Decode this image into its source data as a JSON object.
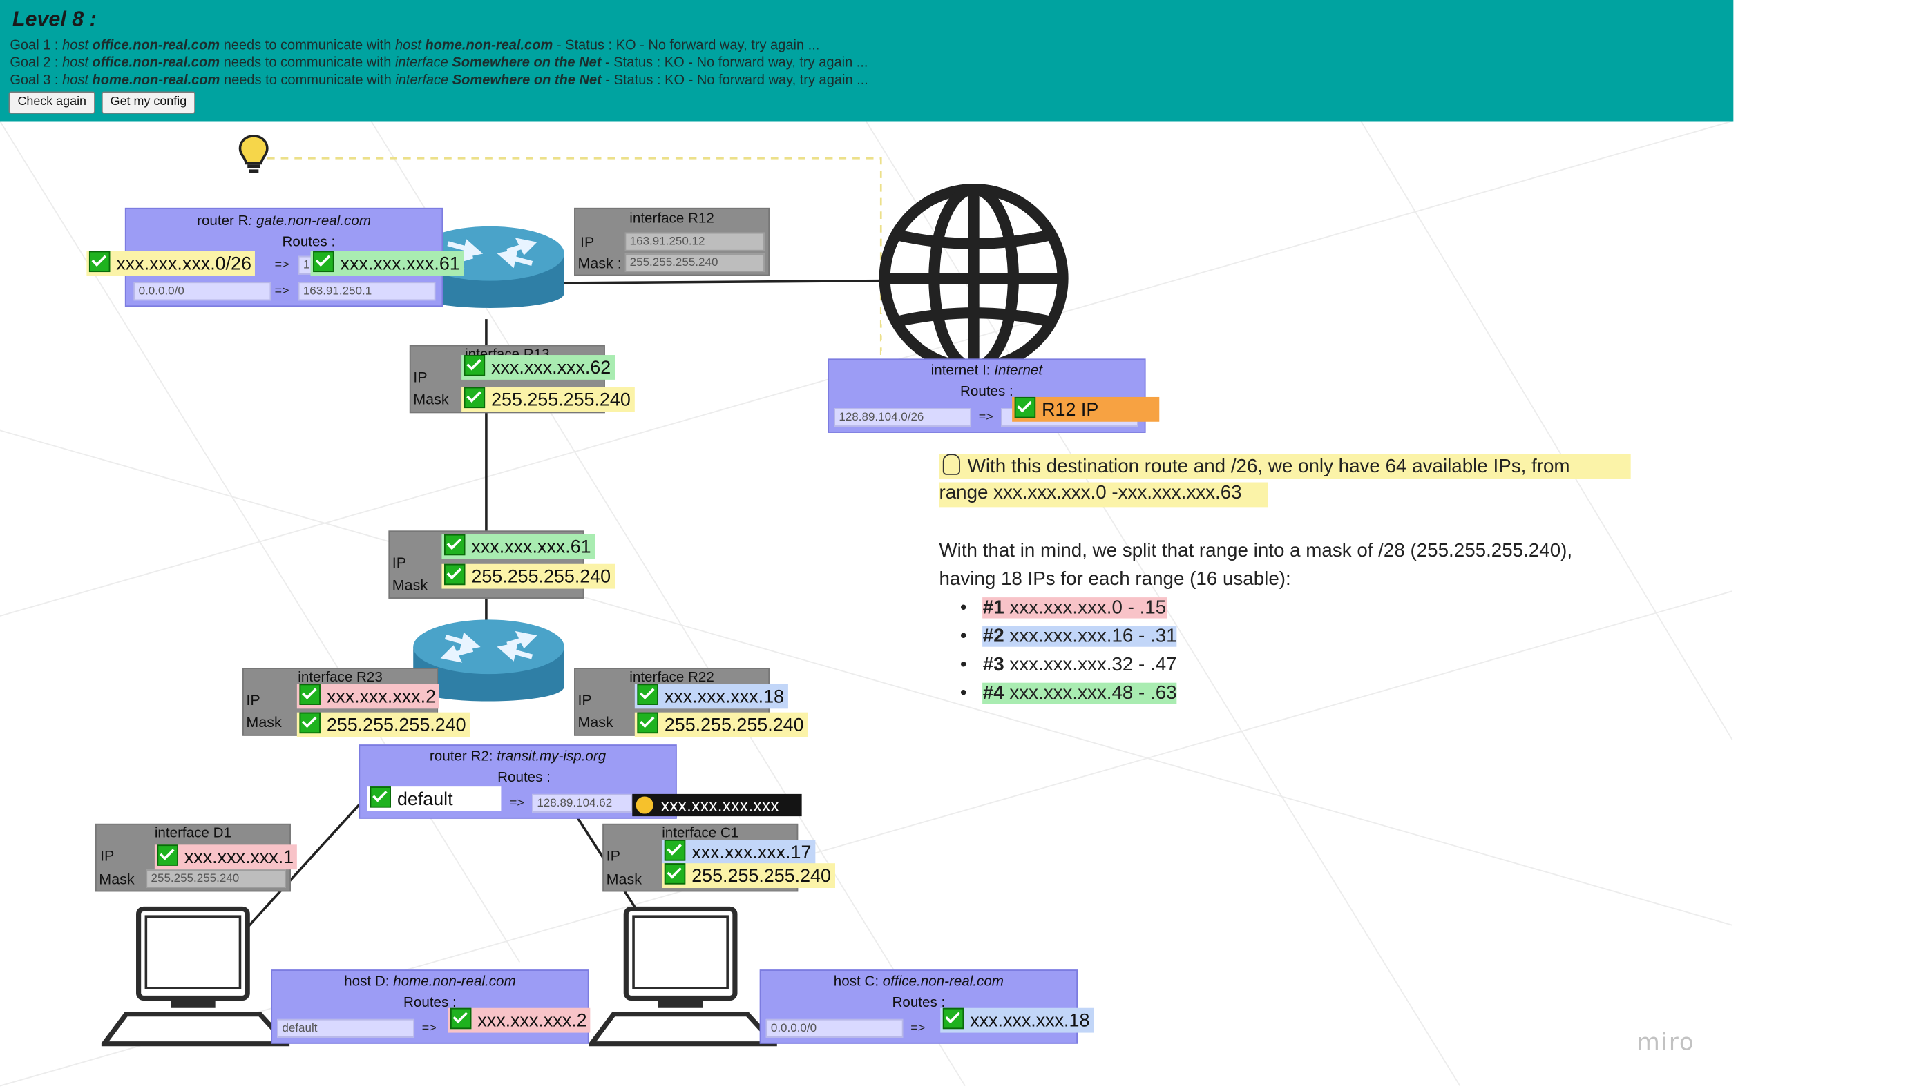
{
  "header": {
    "level": "Level 8 :",
    "goals": [
      {
        "prefix": "Goal 1 : ",
        "t1": "host ",
        "b1": "office.non-real.com",
        "m": " needs to communicate with ",
        "t2": "host ",
        "b2": "home.non-real.com",
        "status": " - Status : KO - No forward way, try again ..."
      },
      {
        "prefix": "Goal 2 : ",
        "t1": "host ",
        "b1": "office.non-real.com",
        "m": " needs to communicate with ",
        "t2": "interface ",
        "b2": "Somewhere on the Net",
        "status": " - Status : KO - No forward way, try again ..."
      },
      {
        "prefix": "Goal 3 : ",
        "t1": "host ",
        "b1": "home.non-real.com",
        "m": " needs to communicate with ",
        "t2": "interface ",
        "b2": "Somewhere on the Net",
        "status": " - Status : KO - No forward way, try again ..."
      }
    ],
    "check_again": "Check again",
    "get_config": "Get my config"
  },
  "router_r1": {
    "title_prefix": "router R",
    "title_rest": ": gate.non-real.com",
    "routes": "Routes :",
    "row1_dest": "xxx.xxx.xxx.0/26",
    "row1_arrow": "=>",
    "row1_mini": "1",
    "row1_next": "xxx.xxx.xxx.61",
    "row2_dest": "0.0.0.0/0",
    "row2_arrow": "=>",
    "row2_next": "163.91.250.1"
  },
  "iface_r12": {
    "title": "interface R12",
    "ip_label": "IP",
    "mask_label": "Mask :",
    "ip": "163.91.250.12",
    "mask": "255.255.255.240"
  },
  "iface_r13": {
    "title": "interface R13",
    "ip_label": "IP",
    "mask_label": "Mask",
    "ip": "xxx.xxx.xxx.62",
    "mask": "255.255.255.240"
  },
  "iface_r21": {
    "ip_label": "IP",
    "mask_label": "Mask",
    "ip": "xxx.xxx.xxx.61",
    "mask": "255.255.255.240"
  },
  "iface_r23": {
    "title": "interface R23",
    "ip_label": "IP",
    "mask_label": "Mask",
    "ip": "xxx.xxx.xxx.2",
    "mask": "255.255.255.240"
  },
  "iface_r22": {
    "title": "interface R22",
    "ip_label": "IP",
    "mask_label": "Mask",
    "ip": "xxx.xxx.xxx.18",
    "mask": "255.255.255.240"
  },
  "router_r2": {
    "title_prefix": "router R2: ",
    "title_rest": "transit.my-isp.org",
    "routes": "Routes :",
    "row1_dest": "default",
    "row1_arrow": "=>",
    "row1_next": "128.89.104.62",
    "row1_tag": "xxx.xxx.xxx.xxx"
  },
  "iface_d1": {
    "title": "interface D1",
    "ip_label": "IP",
    "mask_label": "Mask",
    "ip": "xxx.xxx.xxx.1",
    "mask": "255.255.255.240"
  },
  "iface_c1": {
    "title": "interface C1",
    "ip_label": "IP",
    "mask_label": "Mask",
    "ip": "xxx.xxx.xxx.17",
    "mask": "255.255.255.240"
  },
  "internet": {
    "title_prefix": "internet I: ",
    "title_rest": "Internet",
    "routes": "Routes :",
    "dest": "128.89.104.0/26",
    "arrow": "=>",
    "next": "R12 IP"
  },
  "host_d": {
    "title_prefix": "host D: ",
    "title_rest": "home.non-real.com",
    "routes": "Routes :",
    "dest": "default",
    "arrow": "=>",
    "next": "xxx.xxx.xxx.2"
  },
  "host_c": {
    "title_prefix": "host C: ",
    "title_rest": "office.non-real.com",
    "routes": "Routes :",
    "dest": "0.0.0.0/0",
    "arrow": "=>",
    "next": "xxx.xxx.xxx.18"
  },
  "notes": {
    "line1": "With this destination route and /26, we only have 64 available IPs, from",
    "line2": "range xxx.xxx.xxx.0 -xxx.xxx.xxx.63",
    "line3": "With that in mind, we split that range into a mask of /28 (255.255.255.240),",
    "line4": "having 18 IPs for each range (16 usable):",
    "items": [
      {
        "num": "#1",
        "range": " xxx.xxx.xxx.0 - .15"
      },
      {
        "num": "#2",
        "range": " xxx.xxx.xxx.16 - .31"
      },
      {
        "num": "#3",
        "range": " xxx.xxx.xxx.32 - .47"
      },
      {
        "num": "#4",
        "range": " xxx.xxx.xxx.48 - .63"
      }
    ]
  },
  "watermark": "miro",
  "colors": {
    "header_bg": "#00a3a0",
    "panel_purple": "#9c9cf5",
    "panel_gray": "#8c8c8c",
    "sticky_green": "#a9ecb1",
    "sticky_yellow": "#fbf3a8",
    "sticky_pink": "#f8c3c8",
    "sticky_blue": "#c2d6f8",
    "sticky_orange": "#f7a242",
    "router_blue": "#3a8fb5"
  }
}
